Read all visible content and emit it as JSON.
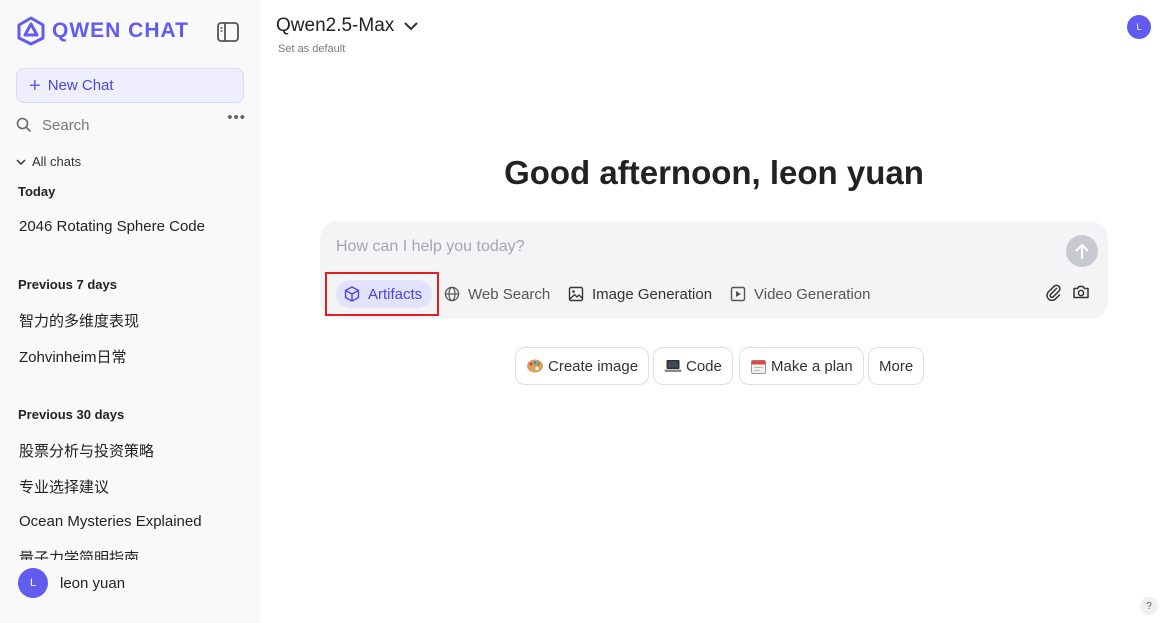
{
  "brand": {
    "name": "QWEN CHAT"
  },
  "sidebar": {
    "new_chat_label": "New Chat",
    "search_label": "Search",
    "more_label": "•••",
    "all_chats_label": "All chats",
    "sections": [
      {
        "heading": "Today",
        "items": [
          "2046 Rotating Sphere Code"
        ]
      },
      {
        "heading": "Previous 7 days",
        "items": [
          "智力的多维度表现",
          "Zohvinheim日常"
        ]
      },
      {
        "heading": "Previous 30 days",
        "items": [
          "股票分析与投资策略",
          "专业选择建议",
          "Ocean Mysteries Explained",
          "量子力学简明指南"
        ]
      }
    ],
    "user": {
      "initial": "L",
      "name": "leon yuan"
    }
  },
  "header": {
    "model_name": "Qwen2.5-Max",
    "set_default": "Set as default",
    "avatar_initial": "L"
  },
  "main": {
    "greeting": "Good afternoon, leon yuan",
    "composer": {
      "placeholder": "How can I help you today?",
      "tools": [
        "Artifacts",
        "Web Search",
        "Image Generation",
        "Video Generation"
      ],
      "active_tool": "Artifacts"
    },
    "chips": [
      "Create image",
      "Code",
      "Make a plan",
      "More"
    ]
  },
  "help_label": "?",
  "colors": {
    "accent": "#615ced",
    "highlight": "#e21f1f",
    "sidebar_bg": "#f9f9fa"
  }
}
